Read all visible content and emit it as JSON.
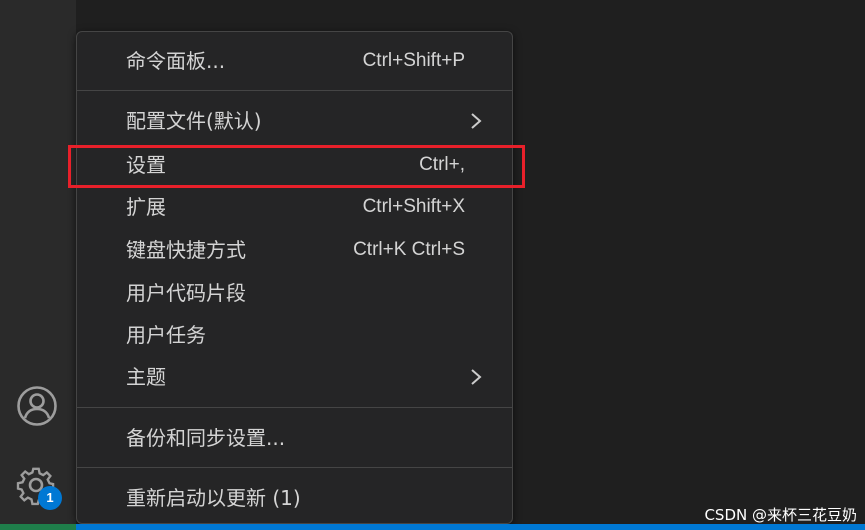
{
  "activity_bar": {
    "icons": [
      "account-icon",
      "settings-gear-icon"
    ],
    "settings_badge": "1",
    "badge_color": "#0078d4"
  },
  "menu": {
    "items": [
      {
        "label": "命令面板...",
        "shortcut": "Ctrl+Shift+P"
      },
      {
        "label": "配置文件(默认)",
        "shortcut": "",
        "submenu": true
      },
      {
        "label": "设置",
        "shortcut": "Ctrl+,",
        "highlighted": true
      },
      {
        "label": "扩展",
        "shortcut": "Ctrl+Shift+X"
      },
      {
        "label": "键盘快捷方式",
        "shortcut": "Ctrl+K Ctrl+S"
      },
      {
        "label": "用户代码片段",
        "shortcut": ""
      },
      {
        "label": "用户任务",
        "shortcut": ""
      },
      {
        "label": "主题",
        "shortcut": "",
        "submenu": true
      },
      {
        "label": "备份和同步设置...",
        "shortcut": ""
      },
      {
        "label": "重新启动以更新 (1)",
        "shortcut": ""
      }
    ]
  },
  "annotation": {
    "highlight_color": "#e8202a"
  },
  "watermark": "CSDN @来杯三花豆奶",
  "colors": {
    "menu_bg": "#252526",
    "activity_bar_bg": "#2a2a2a",
    "editor_bg": "#1f1f1f",
    "status_bar": "#0078d4"
  }
}
